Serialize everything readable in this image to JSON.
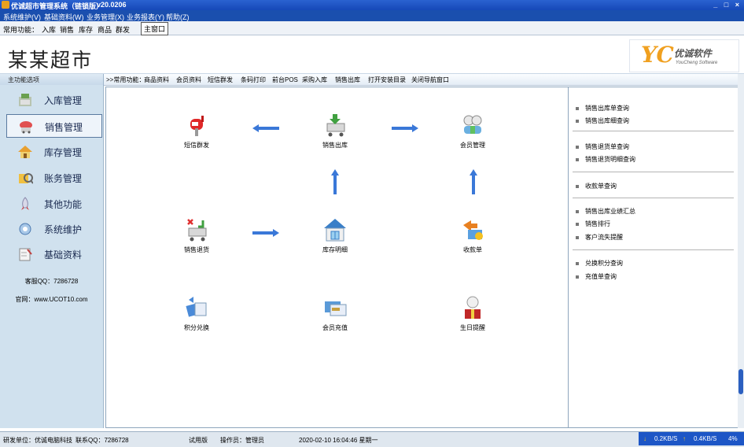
{
  "window": {
    "title": "优诚超市管理系统（链锁版）",
    "version": "v20.0206",
    "controls": "_ □ ×"
  },
  "menu": [
    "系统维护(V)",
    "基础资料(W)",
    "业务管理(X)",
    "业务报表(Y)",
    "帮助(Z)"
  ],
  "quick": {
    "label": "常用功能：",
    "items": [
      "入库",
      "销售",
      "库存",
      "商品",
      "群发"
    ],
    "main_window": "主窗口"
  },
  "banner": {
    "store_name": "某某超市",
    "logo_mark": "YC",
    "logo_cn": "优诚软件",
    "logo_en": "YouCheng Software"
  },
  "sidebar": {
    "title": "主功能选项",
    "items": [
      {
        "label": "入库管理",
        "icon": "inbound-icon"
      },
      {
        "label": "销售管理",
        "icon": "sales-icon"
      },
      {
        "label": "库存管理",
        "icon": "house-icon"
      },
      {
        "label": "账务管理",
        "icon": "account-icon"
      },
      {
        "label": "其他功能",
        "icon": "rocket-icon"
      },
      {
        "label": "系统维护",
        "icon": "maintenance-icon"
      },
      {
        "label": "基础资料",
        "icon": "notebook-icon"
      }
    ],
    "service_qq": "客服QQ：7286728",
    "website": "官网：www.UCOT10.com"
  },
  "content_bar": {
    "label": ">>常用功能：",
    "items": [
      "商品资料",
      "会员资料",
      "短信群发",
      "条码打印",
      "前台POS",
      "采购入库",
      "销售出库",
      "打开安装目录",
      "关闭导航窗口"
    ]
  },
  "functions": [
    {
      "label": "短信群发",
      "icon": "mailbox-icon"
    },
    {
      "label": "销售出库",
      "icon": "cart-out-icon"
    },
    {
      "label": "会员管理",
      "icon": "members-icon"
    },
    {
      "label": "销售退货",
      "icon": "cart-return-icon"
    },
    {
      "label": "库存明细",
      "icon": "warehouse-icon"
    },
    {
      "label": "收款单",
      "icon": "receipt-icon"
    },
    {
      "label": "积分兑换",
      "icon": "points-icon"
    },
    {
      "label": "会员充值",
      "icon": "vip-card-icon"
    },
    {
      "label": "生日提醒",
      "icon": "birthday-icon"
    }
  ],
  "right_panel": {
    "links": [
      "销售出库单查询",
      "销售出库细查询",
      "销售退货单查询",
      "销售退货明细查询",
      "收款单查询",
      "销售出库业绩汇总",
      "销售排行",
      "客户流失提醒",
      "兑换积分查询",
      "充值单查询"
    ]
  },
  "status": {
    "developer": "研发单位：优诚电脑科技",
    "qq": "联系QQ：7286728",
    "edition": "试用版",
    "operator": "操作员：管理员",
    "datetime": "2020-02-10  16:04:46 星期一"
  },
  "network": {
    "down": "0.2KB/S",
    "up": "0.4KB/S",
    "percent": "4%"
  },
  "colors": {
    "title_bar": "#1a4fae",
    "sidebar_bg": "#d0e1ee",
    "arrow_blue": "#3a78d8",
    "accent_orange": "#f0a020"
  }
}
